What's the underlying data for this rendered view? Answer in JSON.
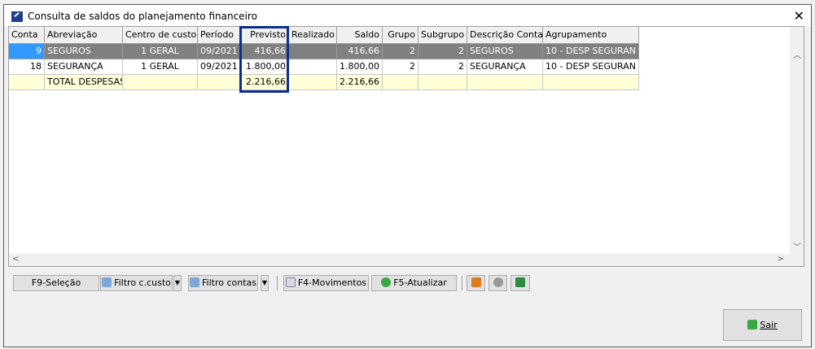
{
  "window": {
    "title": "Consulta de saldos do planejamento financeiro",
    "close_label": "✕"
  },
  "grid": {
    "columns": [
      "Conta",
      "Abreviação",
      "Centro de custo",
      "Período",
      "Previsto",
      "Realizado",
      "Saldo",
      "Grupo",
      "Subgrupo",
      "Descrição Conta",
      "Agrupamento"
    ],
    "rows": [
      [
        "9",
        "SEGUROS",
        "1 GERAL",
        "09/2021",
        "416,66",
        "",
        "416,66",
        "2",
        "2",
        "SEGUROS",
        "10 - DESP SEGURAN"
      ],
      [
        "18",
        "SEGURANÇA",
        "1 GERAL",
        "09/2021",
        "1.800,00",
        "",
        "1.800,00",
        "2",
        "2",
        "SEGURANÇA",
        "10 - DESP SEGURAN"
      ],
      [
        "",
        "TOTAL DESPESAS",
        "",
        "",
        "2.216,66",
        "",
        "2.216,66",
        "",
        "",
        "",
        ""
      ]
    ],
    "selected_row": 0,
    "highlighted_column": "Previsto"
  },
  "toolbar": {
    "f9": "F9-Seleção",
    "filtro_ccusto": "Filtro c.custo",
    "filtro_contas": "Filtro contas",
    "f4": "F4-Movimentos",
    "f5": "F5-Atualizar"
  },
  "footer": {
    "sair": "Sair"
  },
  "colors": {
    "selected_row": "#808080",
    "selected_cell": "#3399ff",
    "total_row": "#ffffd8",
    "highlight_border": "#0b2e8f"
  }
}
